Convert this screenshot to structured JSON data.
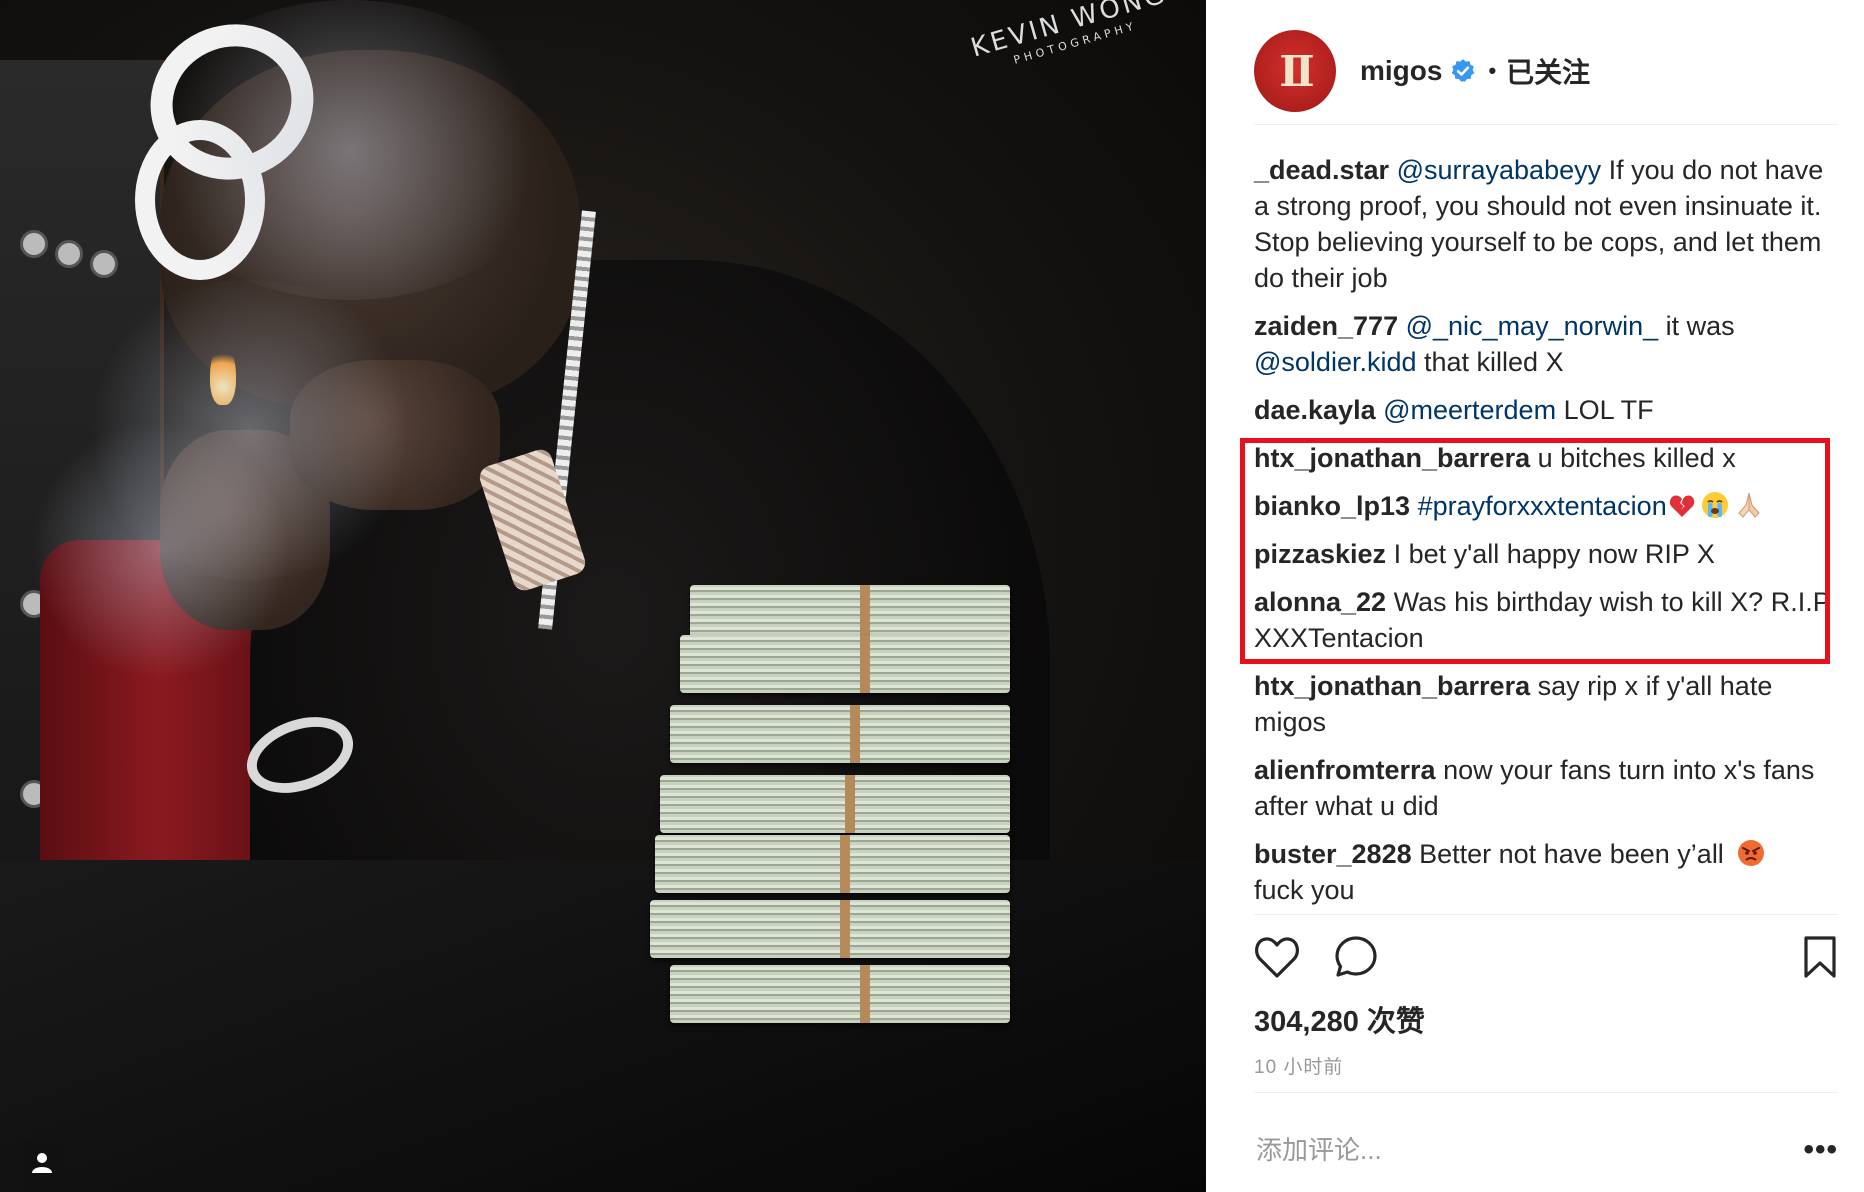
{
  "photo": {
    "watermark_top": "KEVIN WONG",
    "watermark_bottom": "PHOTOGRAPHY"
  },
  "post": {
    "username": "migos",
    "separator": "•",
    "follow_status": "已关注",
    "avatar_icon": "migos-logo",
    "likes": "304,280 次赞",
    "time": "10 小时前",
    "add_comment_placeholder": "添加评论...",
    "more_label": "•••"
  },
  "comments": [
    {
      "user": "_dead.star",
      "mention": "@surrayababeyy",
      "text": " If you do not have a strong proof, you should not even insinuate it. Stop believing yourself to be cops, and let them do their job"
    },
    {
      "user": "zaiden_777",
      "mention": "@_nic_may_norwin_",
      "text": " it was ",
      "mention2": "@soldier.kidd",
      "text2": " that killed X"
    },
    {
      "user": "dae.kayla",
      "mention": "@meerterdem",
      "text": " LOL TF"
    },
    {
      "user": "htx_jonathan_barrera",
      "text": " u bitches killed x"
    },
    {
      "user": "bianko_lp13",
      "mention": "#prayforxxxtentacion",
      "emojis": [
        "broken-heart-icon",
        "crying-face-icon",
        "praying-hands-icon"
      ]
    },
    {
      "user": "pizzaskiez",
      "text": " I bet y'all happy now RIP X"
    },
    {
      "user": "alonna_22",
      "text": " Was his birthday wish to kill X? R.I.P XXXTentacion"
    },
    {
      "user": "htx_jonathan_barrera",
      "text": " say rip x if y'all hate migos"
    },
    {
      "user": "alienfromterra",
      "text": " now your fans turn into x's fans after what u did"
    },
    {
      "user": "buster_2828",
      "text": " Better not have been y’all ",
      "text2": " fuck you",
      "emojis": [
        "angry-face-icon"
      ]
    }
  ],
  "colors": {
    "mention": "#003569",
    "highlight": "#e8101b",
    "verified": "#3897f0",
    "avatar": "#c0282a"
  }
}
